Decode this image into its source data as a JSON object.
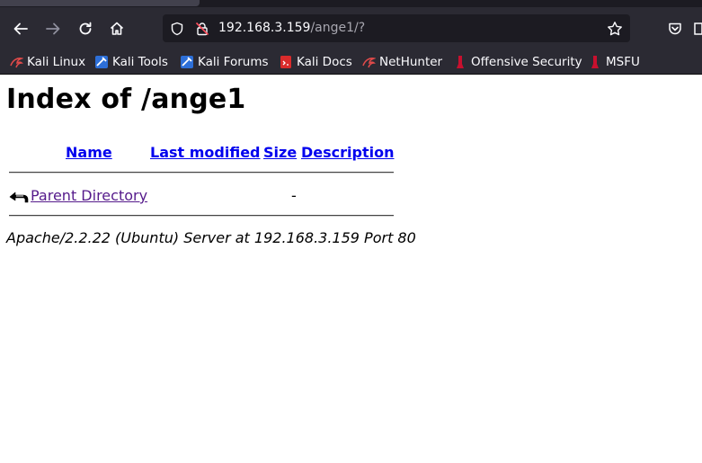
{
  "browser": {
    "url_host": "192.168.3.159",
    "url_path": "/ange1/?"
  },
  "bookmarks": [
    {
      "label": "Kali Linux",
      "icon": "kali-dragon-icon"
    },
    {
      "label": "Kali Tools",
      "icon": "kali-tools-icon"
    },
    {
      "label": "Kali Forums",
      "icon": "kali-forums-icon"
    },
    {
      "label": "Kali Docs",
      "icon": "kali-docs-icon"
    },
    {
      "label": "NetHunter",
      "icon": "nethunter-icon"
    },
    {
      "label": "Offensive Security",
      "icon": "offsec-icon"
    },
    {
      "label": "MSFU",
      "icon": "msfu-icon"
    }
  ],
  "page": {
    "title": "Index of /ange1",
    "columns": {
      "name": "Name",
      "last_modified": "Last modified",
      "size": "Size",
      "description": "Description"
    },
    "rows": [
      {
        "name": "Parent Directory",
        "size": "-",
        "icon": "back-arrow-icon"
      }
    ],
    "address": "Apache/2.2.22 (Ubuntu) Server at 192.168.3.159 Port 80"
  },
  "colors": {
    "link": "#0000ee",
    "visited_link": "#551a8b",
    "chrome_bg": "#2b2a33",
    "urlbar_bg": "#1c1b22"
  }
}
